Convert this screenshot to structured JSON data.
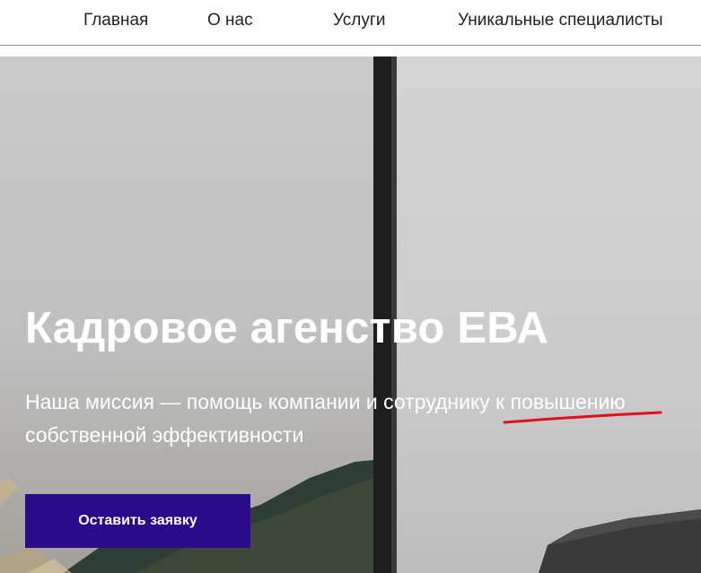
{
  "nav": {
    "items": [
      {
        "label": "Главная"
      },
      {
        "label": "О нас"
      },
      {
        "label": "Услуги"
      },
      {
        "label": "Уникальные специалисты"
      }
    ]
  },
  "hero": {
    "title": "Кадровое агенство ЕВА",
    "subtitle_line1": "Наша миссия — помощь компании и сотруднику к повышению",
    "subtitle_line2": "собственной эффективности",
    "cta_label": "Оставить заявку"
  },
  "colors": {
    "cta_background": "#2b0a8c",
    "annotation_underline": "#e0101a",
    "nav_divider": "#8a8a8a"
  }
}
